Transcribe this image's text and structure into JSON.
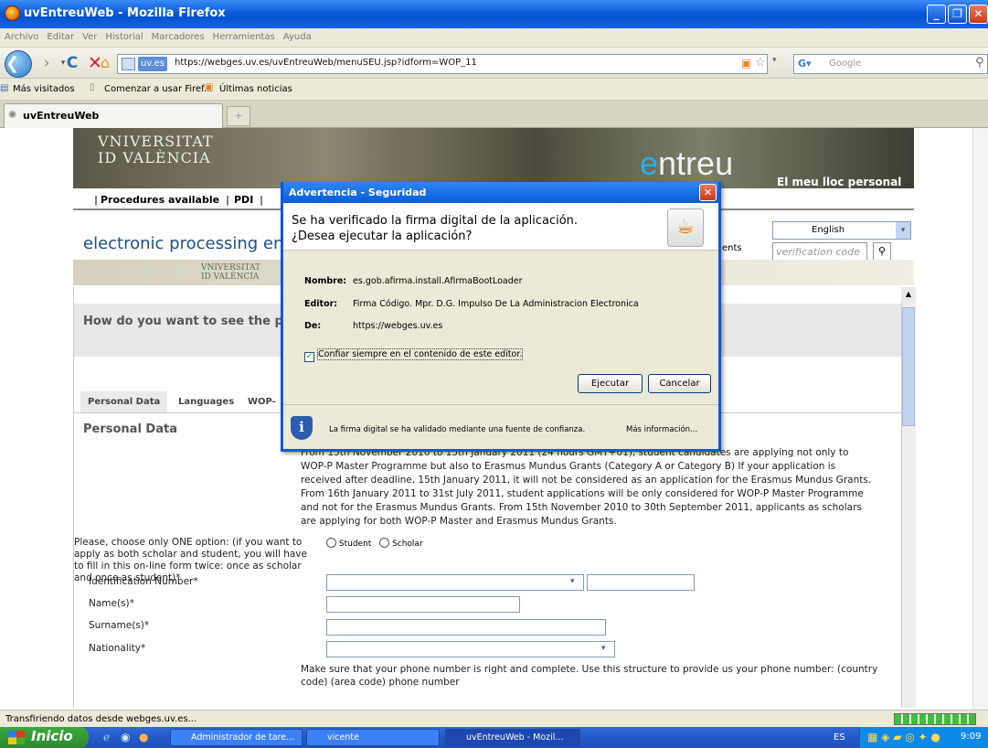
{
  "window": {
    "title": "uvEntreuWeb - Mozilla Firefox"
  },
  "menu": [
    "Archivo",
    "Editar",
    "Ver",
    "Historial",
    "Marcadores",
    "Herramientas",
    "Ayuda"
  ],
  "nav": {
    "domain": "uv.es",
    "url": "https://webges.uv.es/uvEntreuWeb/menuSEU.jsp?idform=WOP_11",
    "search_placeholder": "Google"
  },
  "bookmarks": [
    "Más visitados",
    "Comenzar a usar Firef...",
    "Últimas noticias"
  ],
  "tab": {
    "label": "uvEntreuWeb"
  },
  "page": {
    "logo_l1": "VNIVERSITAT",
    "logo_l2": "ID VALÈNCIA",
    "entreu_e": "e",
    "entreu_rest": "ntreu",
    "lloc": "El meu lloc personal",
    "proc_nav": [
      "Procedures available",
      "PDI"
    ],
    "electronic": "electronic processing env",
    "lang": "English",
    "ents": "ents",
    "verif_placeholder": "verification code",
    "mini_logo_1": "VNIVERSITAT",
    "mini_logo_2": "ID VALÈNCIA",
    "howdo": "How do you want to see the proc",
    "tabs": [
      "Personal Data",
      "Languages",
      "WOP-"
    ],
    "section": "Personal Data",
    "para": "From 15th November 2010 to 15th January 2011 (24 hours GMT+01), student candidates are applying not only to WOP-P Master Programme but also to Erasmus Mundus Grants (Category A or Category B) If your application is received after deadline, 15th January 2011, it will not be considered as an application for the Erasmus Mundus Grants. From 16th January 2011 to 31st July 2011, student applications will be only considered for WOP-P Master Programme and not for the Erasmus Mundus Grants. From 15th November 2010 to 30th September 2011, applicants as scholars are applying for both WOP-P Master and Erasmus Mundus Grants.",
    "option_label": "Please, choose only ONE option: (if you want to apply as both scholar and student, you will have to fill in this on-line form twice: once as scholar and once as student)*",
    "radio_student": "Student",
    "radio_scholar": "Scholar",
    "fields": {
      "id": "Identification Number*",
      "name": "Name(s)*",
      "surname": "Surname(s)*",
      "nationality": "Nationality*"
    },
    "phone_note": "Make sure that your phone number is right and complete. Use this structure to provide us your phone number: (country code) (area code) phone number"
  },
  "dialog": {
    "title": "Advertencia - Seguridad",
    "msg1": "Se ha verificado la firma digital de la aplicación.",
    "msg2": "¿Desea ejecutar la aplicación?",
    "nombre_k": "Nombre:",
    "nombre_v": "es.gob.afirma.install.AfirmaBootLoader",
    "editor_k": "Editor:",
    "editor_v": "Firma Código. Mpr. D.G. Impulso De La Administracion Electronica",
    "de_k": "De:",
    "de_v": "https://webges.uv.es",
    "checkbox": "Confiar siempre en el contenido de este editor.",
    "run": "Ejecutar",
    "cancel": "Cancelar",
    "foot": "La firma digital se ha validado mediante una fuente de confianza.",
    "more": "Más información..."
  },
  "status": "Transfiriendo datos desde webges.uv.es...",
  "taskbar": {
    "start": "Inicio",
    "items": [
      "Administrador de tare...",
      "vicente",
      "uvEntreuWeb - Mozil..."
    ],
    "lang": "ES",
    "clock": "9:09"
  }
}
